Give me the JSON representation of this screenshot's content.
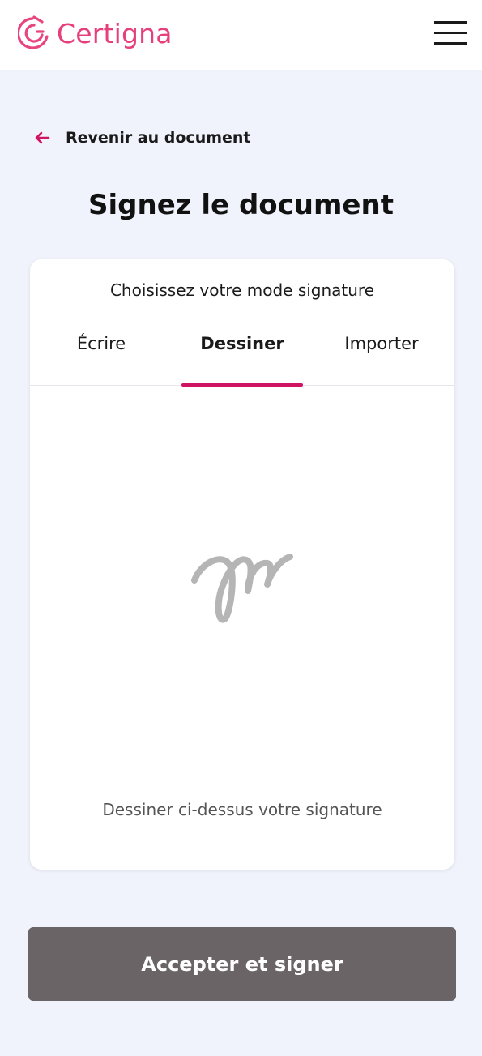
{
  "brand": {
    "name": "Certigna",
    "color": "#e63f7b",
    "logo_icon": "certigna-logo-icon"
  },
  "header": {
    "menu_icon": "hamburger-menu-icon"
  },
  "nav": {
    "back_label": "Revenir au document",
    "back_icon": "arrow-left-icon",
    "accent": "#d01464"
  },
  "page": {
    "title": "Signez le document"
  },
  "signature_card": {
    "subtitle": "Choisissez votre mode signature",
    "tabs": [
      {
        "label": "Écrire",
        "active": false
      },
      {
        "label": "Dessiner",
        "active": true
      },
      {
        "label": "Importer",
        "active": false
      }
    ],
    "draw_hint": "Dessiner ci-dessus votre signature",
    "placeholder_icon": "signature-squiggle-icon"
  },
  "actions": {
    "submit_label": "Accepter et signer",
    "submit_color": "#6b6466"
  },
  "colors": {
    "background": "#f0f3fb",
    "card": "#ffffff",
    "active_tab_underline": "#d01464"
  }
}
